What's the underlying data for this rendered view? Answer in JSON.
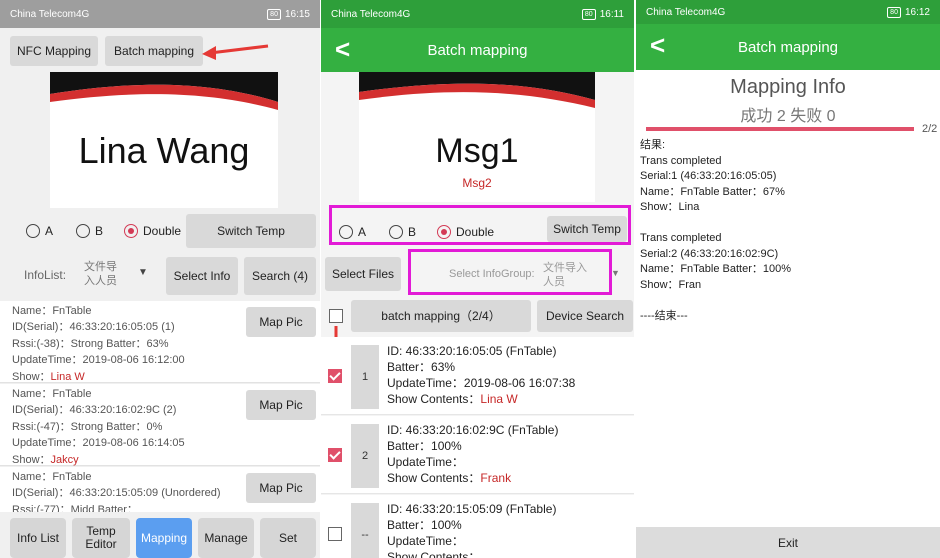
{
  "panel1": {
    "statusbar": {
      "carrier": "China Telecom4G",
      "time": "16:15",
      "battery": "80"
    },
    "top_buttons": {
      "nfc": "NFC Mapping",
      "batch": "Batch mapping"
    },
    "tag_name": "Lina Wang",
    "radios": {
      "a": "A",
      "b": "B",
      "double": "Double"
    },
    "switch_temp": "Switch Temp",
    "infolist_label": "InfoList:",
    "infolist_value": "文件导入人员",
    "select_info": "Select Info",
    "search": "Search (4)",
    "items": [
      {
        "name": "Name：FnTable",
        "id": "ID(Serial)：46:33:20:16:05:05  (1)",
        "rssi": "Rssi:(-38)：Strong   Batter：63%",
        "update": "UpdateTime：2019-08-06 16:12:00",
        "show_label": "Show：",
        "show_value": "Lina W",
        "btn": "Map Pic"
      },
      {
        "name": "Name：FnTable",
        "id": "ID(Serial)：46:33:20:16:02:9C  (2)",
        "rssi": "Rssi:(-47)：Strong   Batter：0%",
        "update": "UpdateTime：2019-08-06 16:14:05",
        "show_label": "Show：",
        "show_value": "Jakcy",
        "btn": "Map Pic"
      },
      {
        "name": "Name：FnTable",
        "id": "ID(Serial)：46:33:20:15:05:09  (Unordered)",
        "rssi": "Rssi:(-77)：Midd   Batter：",
        "btn": "Map Pic"
      }
    ],
    "nav": [
      "Info List",
      "Temp Editor",
      "Mapping",
      "Manage",
      "Set"
    ]
  },
  "panel2": {
    "statusbar": {
      "carrier": "China Telecom4G",
      "time": "16:11",
      "battery": "80"
    },
    "title": "Batch mapping",
    "tag_msg": "Msg1",
    "tag_sub": "Msg2",
    "radios": {
      "a": "A",
      "b": "B",
      "double": "Double"
    },
    "switch_temp": "Switch Temp",
    "select_files": "Select Files",
    "infogroup_label": "Select InfoGroup:",
    "infogroup_value": "文件导入人员",
    "batch_mapping": "batch mapping（2/4）",
    "device_search": "Device Search",
    "rows": [
      {
        "num": "1",
        "id": "ID: 46:33:20:16:05:05 (FnTable)",
        "batter": "Batter：63%",
        "update": "UpdateTime：2019-08-06 16:07:38",
        "show_label": "Show Contents：",
        "show_value": "Lina W"
      },
      {
        "num": "2",
        "id": "ID: 46:33:20:16:02:9C (FnTable)",
        "batter": "Batter：100%",
        "update": "UpdateTime：",
        "show_label": "Show Contents：",
        "show_value": "Frank"
      },
      {
        "num": "--",
        "id": "ID: 46:33:20:15:05:09 (FnTable)",
        "batter": "Batter：100%",
        "update": "UpdateTime：",
        "show_label": "Show Contents：",
        "show_value": ""
      }
    ]
  },
  "panel3": {
    "statusbar": {
      "carrier": "China Telecom4G",
      "time": "16:12",
      "battery": "80"
    },
    "title": "Batch mapping",
    "mapping_info": "Mapping Info",
    "counts": "成功 2  失败 0",
    "progress_label": "2/2",
    "progress_fraction": 1.0,
    "result_lines": [
      "结果:",
      "Trans completed",
      "Serial:1 (46:33:20:16:05:05)",
      "Name：FnTable Batter：67%",
      "Show：Lina",
      "",
      "Trans completed",
      "Serial:2 (46:33:20:16:02:9C)",
      "Name：FnTable Batter：100%",
      "Show：Fran",
      "",
      "----结束---"
    ],
    "exit": "Exit"
  },
  "colors": {
    "green": "#34b041",
    "accent_red": "#c62828",
    "highlight": "#e21ad6",
    "nav_active": "#5b9ef0"
  }
}
